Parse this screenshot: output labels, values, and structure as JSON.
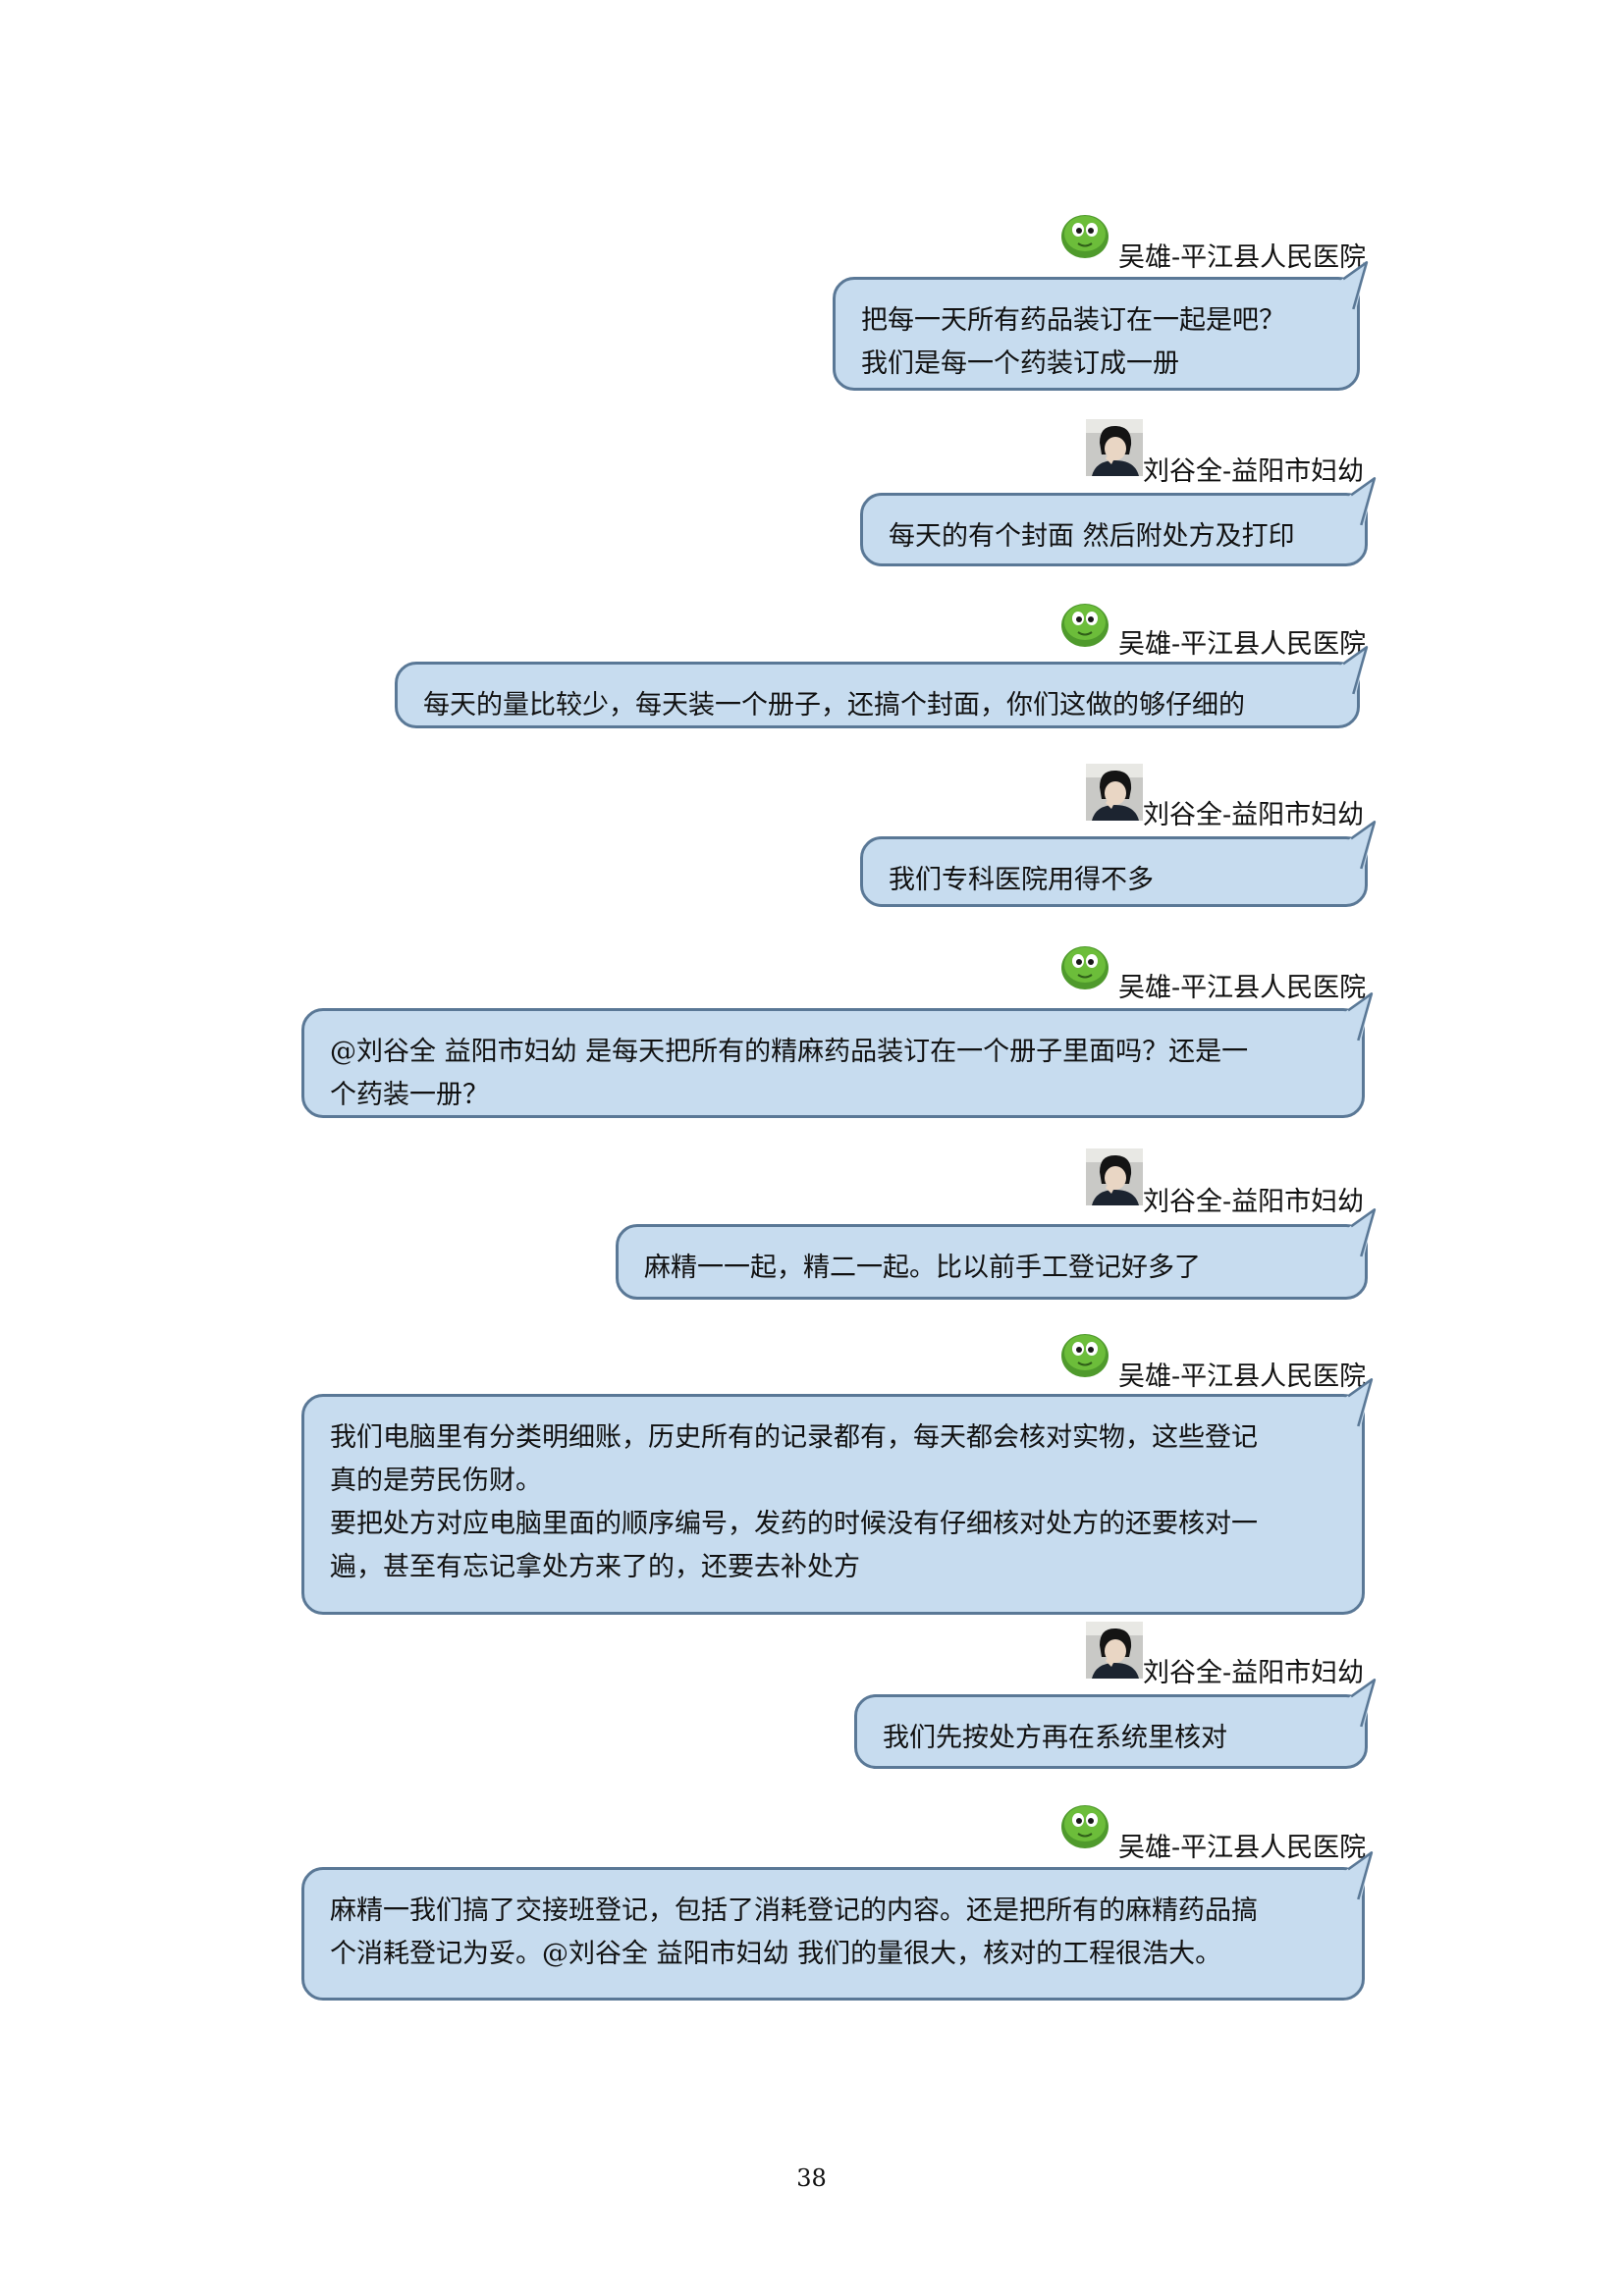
{
  "messages": [
    {
      "sender": "吴雄-平江县人民医院",
      "avatar": "green-blob-avatar",
      "lines": [
        "把每一天所有药品装订在一起是吧？",
        "我们是每一个药装订成一册"
      ]
    },
    {
      "sender": "刘谷全-益阳市妇幼",
      "avatar": "person-photo-avatar",
      "lines": [
        "每天的有个封面  然后附处方及打印"
      ]
    },
    {
      "sender": "吴雄-平江县人民医院",
      "avatar": "green-blob-avatar",
      "lines": [
        "每天的量比较少，每天装一个册子，还搞个封面，你们这做的够仔细的"
      ]
    },
    {
      "sender": "刘谷全-益阳市妇幼",
      "avatar": "person-photo-avatar",
      "lines": [
        "我们专科医院用得不多"
      ]
    },
    {
      "sender": "吴雄-平江县人民医院",
      "avatar": "green-blob-avatar",
      "lines": [
        "@刘谷全  益阳市妇幼 是每天把所有的精麻药品装订在一个册子里面吗？还是一",
        "个药装一册？"
      ]
    },
    {
      "sender": "刘谷全-益阳市妇幼",
      "avatar": "person-photo-avatar",
      "lines": [
        "麻精一一起，精二一起。比以前手工登记好多了"
      ]
    },
    {
      "sender": "吴雄-平江县人民医院",
      "avatar": "green-blob-avatar",
      "lines": [
        "我们电脑里有分类明细账，历史所有的记录都有，每天都会核对实物，这些登记",
        "真的是劳民伤财。",
        "要把处方对应电脑里面的顺序编号，发药的时候没有仔细核对处方的还要核对一",
        "遍，甚至有忘记拿处方来了的，还要去补处方"
      ]
    },
    {
      "sender": "刘谷全-益阳市妇幼",
      "avatar": "person-photo-avatar",
      "lines": [
        "我们先按处方再在系统里核对"
      ]
    },
    {
      "sender": "吴雄-平江县人民医院",
      "avatar": "green-blob-avatar",
      "lines": [
        "麻精一我们搞了交接班登记，包括了消耗登记的内容。还是把所有的麻精药品搞",
        "个消耗登记为妥。@刘谷全  益阳市妇幼 我们的量很大，核对的工程很浩大。"
      ]
    }
  ],
  "page_number": "38",
  "colors": {
    "bubble_fill": "#c7dcef",
    "bubble_border": "#5a7896"
  }
}
